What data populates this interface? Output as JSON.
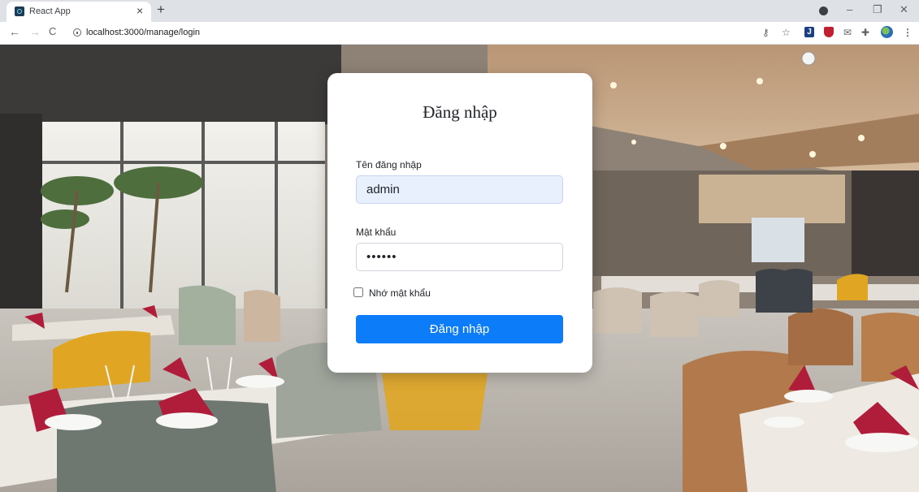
{
  "browser": {
    "tab_title": "React App",
    "tab_close": "×",
    "new_tab": "+",
    "url": "localhost:3000/manage/login",
    "window_controls": {
      "minimize": "–",
      "restore": "❐",
      "close": "✕"
    },
    "nav": {
      "back": "←",
      "forward": "→",
      "reload": "C"
    },
    "toolbar_icons": [
      "key-icon",
      "star-icon",
      "extension-j-icon",
      "ublock-icon",
      "mail-icon",
      "puzzle-icon",
      "profile-icon",
      "more-icon"
    ],
    "ext_j_label": "J"
  },
  "login": {
    "title": "Đăng nhập",
    "username_label": "Tên đăng nhập",
    "username_value": "admin",
    "password_label": "Mật khẩu",
    "password_value": "••••••",
    "remember_label": "Nhớ mật khẩu",
    "submit_label": "Đăng nhập",
    "button_color": "#0d7cf8"
  }
}
